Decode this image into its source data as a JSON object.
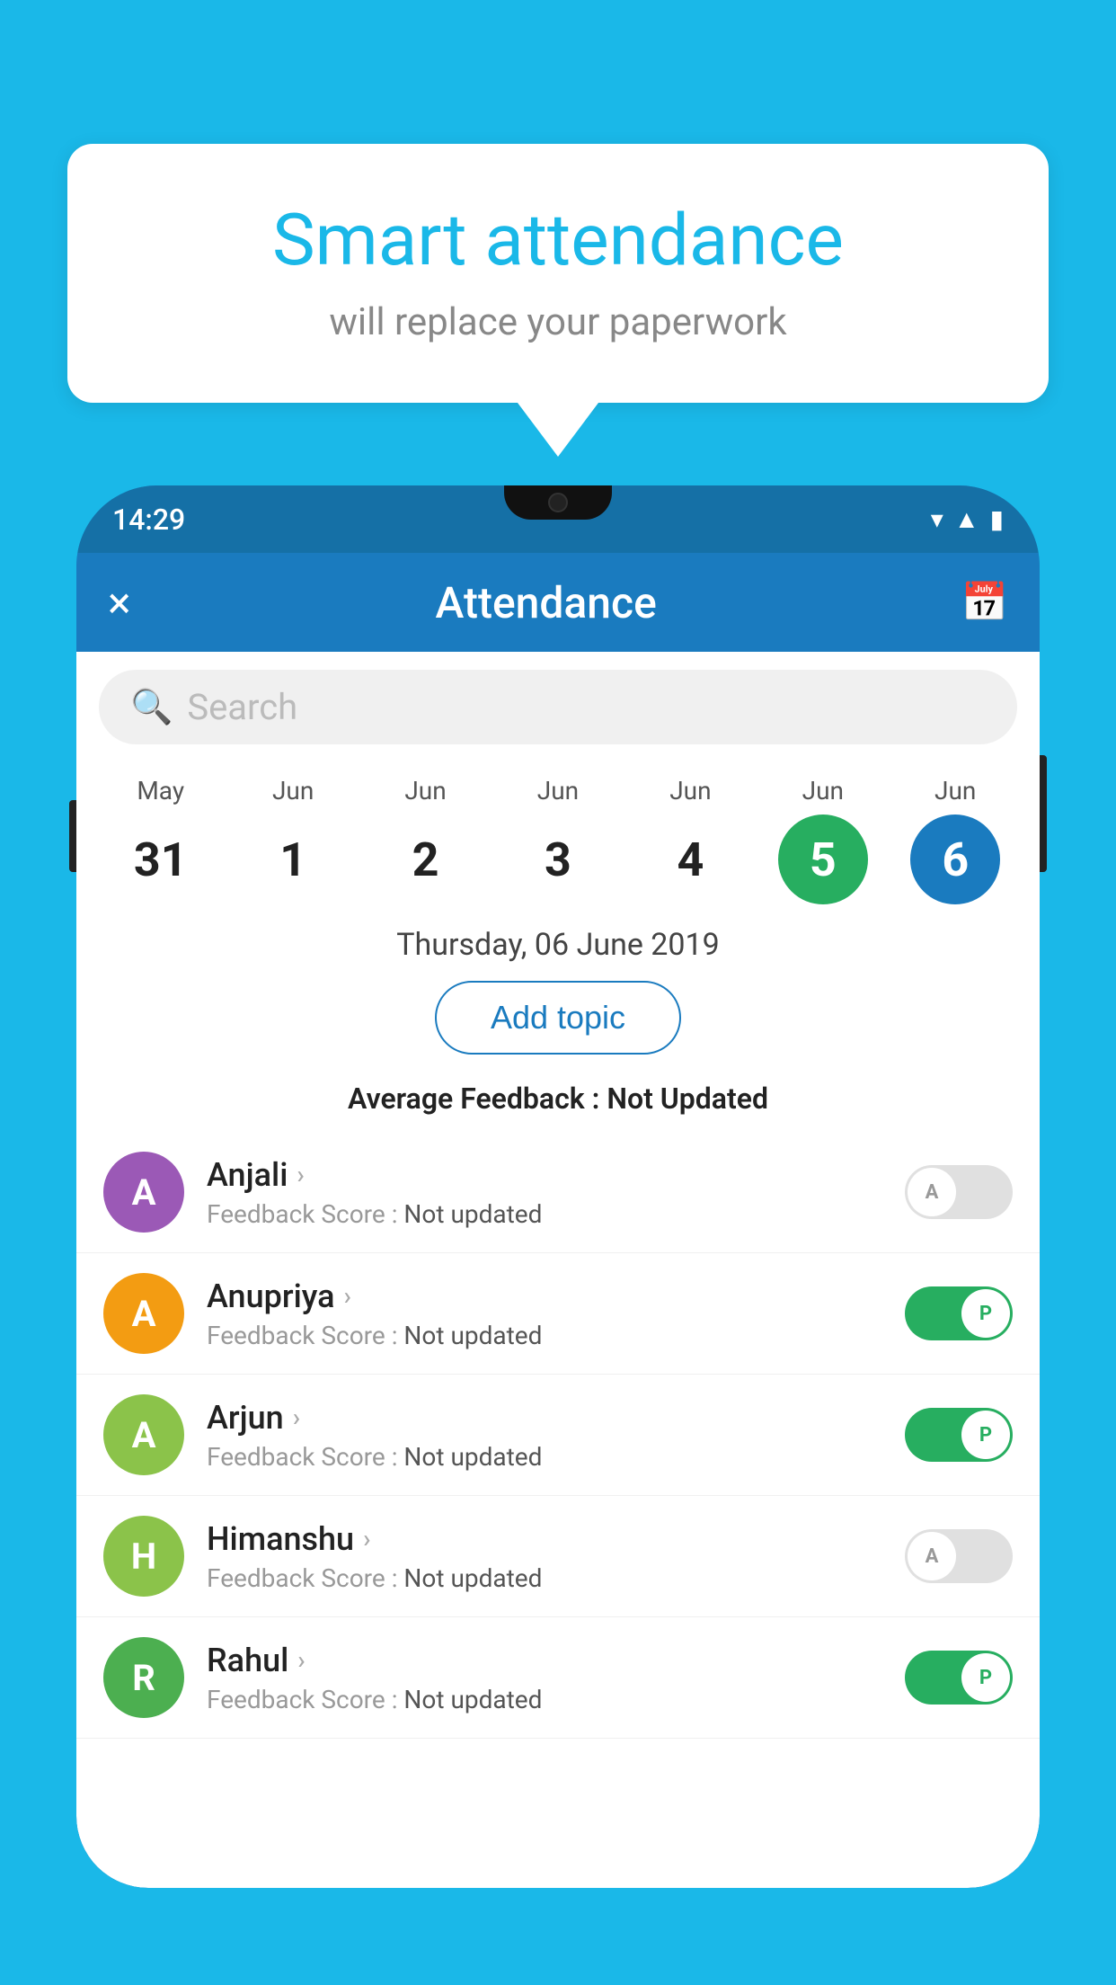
{
  "background_color": "#1ab8e8",
  "speech_bubble": {
    "title": "Smart attendance",
    "subtitle": "will replace your paperwork"
  },
  "phone": {
    "status_bar": {
      "time": "14:29",
      "icons": [
        "wifi",
        "signal",
        "battery"
      ]
    },
    "header": {
      "title": "Attendance",
      "close_label": "×",
      "calendar_label": "📅"
    },
    "search": {
      "placeholder": "Search"
    },
    "calendar": {
      "days": [
        {
          "month": "May",
          "num": "31",
          "highlight": "none"
        },
        {
          "month": "Jun",
          "num": "1",
          "highlight": "none"
        },
        {
          "month": "Jun",
          "num": "2",
          "highlight": "none"
        },
        {
          "month": "Jun",
          "num": "3",
          "highlight": "none"
        },
        {
          "month": "Jun",
          "num": "4",
          "highlight": "none"
        },
        {
          "month": "Jun",
          "num": "5",
          "highlight": "green"
        },
        {
          "month": "Jun",
          "num": "6",
          "highlight": "blue"
        }
      ]
    },
    "selected_date": "Thursday, 06 June 2019",
    "add_topic_label": "Add topic",
    "avg_feedback_label": "Average Feedback : ",
    "avg_feedback_value": "Not Updated",
    "students": [
      {
        "name": "Anjali",
        "avatar_letter": "A",
        "avatar_color": "#9b59b6",
        "feedback_label": "Feedback Score : ",
        "feedback_value": "Not updated",
        "attendance": "absent",
        "toggle_letter": "A"
      },
      {
        "name": "Anupriya",
        "avatar_letter": "A",
        "avatar_color": "#f39c12",
        "feedback_label": "Feedback Score : ",
        "feedback_value": "Not updated",
        "attendance": "present",
        "toggle_letter": "P"
      },
      {
        "name": "Arjun",
        "avatar_letter": "A",
        "avatar_color": "#8bc34a",
        "feedback_label": "Feedback Score : ",
        "feedback_value": "Not updated",
        "attendance": "present",
        "toggle_letter": "P"
      },
      {
        "name": "Himanshu",
        "avatar_letter": "H",
        "avatar_color": "#8bc34a",
        "feedback_label": "Feedback Score : ",
        "feedback_value": "Not updated",
        "attendance": "absent",
        "toggle_letter": "A"
      },
      {
        "name": "Rahul",
        "avatar_letter": "R",
        "avatar_color": "#4caf50",
        "feedback_label": "Feedback Score : ",
        "feedback_value": "Not updated",
        "attendance": "present",
        "toggle_letter": "P"
      }
    ]
  }
}
